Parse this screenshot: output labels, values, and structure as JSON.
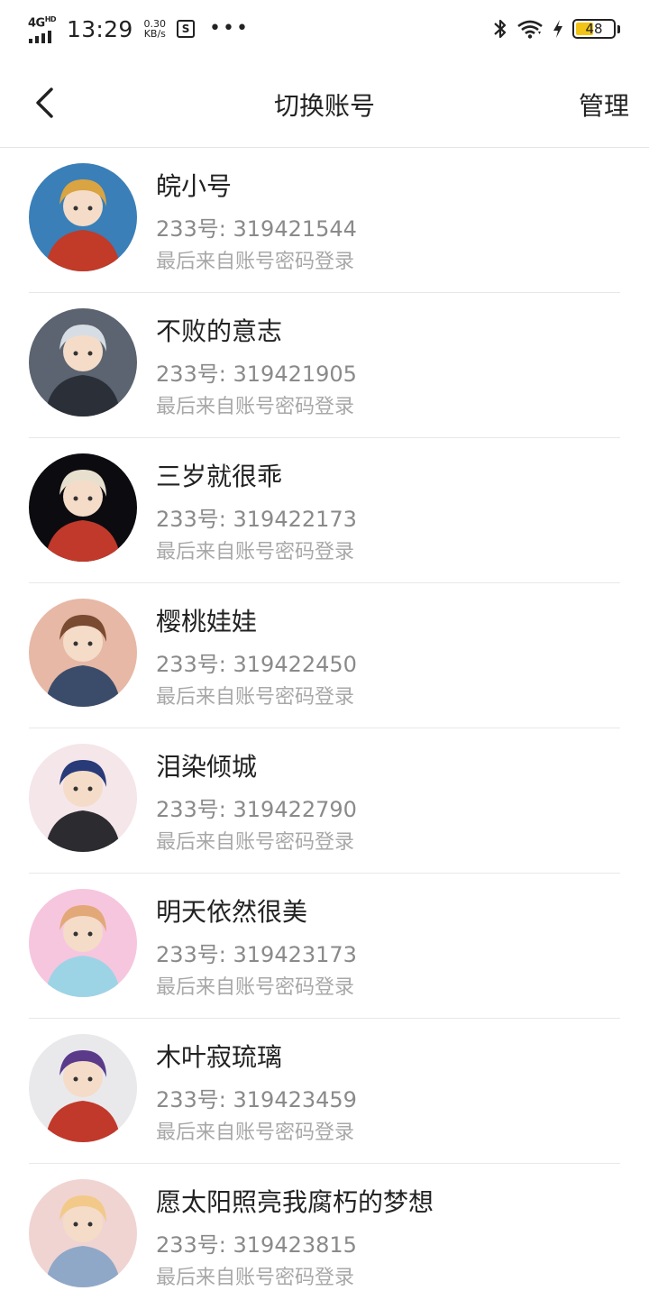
{
  "status_bar": {
    "network": "4G",
    "network_sup": "HD",
    "time": "13:29",
    "speed_value": "0.30",
    "speed_unit": "KB/s",
    "sim_glyph": "S",
    "more": "•••",
    "battery_level": "48",
    "battery_fraction": 0.48,
    "battery_color": "#f2c418",
    "icons": [
      "bluetooth-icon",
      "wifi-icon",
      "charging-icon",
      "battery-icon"
    ]
  },
  "header": {
    "back_icon": "chevron-left-icon",
    "title": "切换账号",
    "manage_label": "管理"
  },
  "accounts": [
    {
      "name": "皖小号",
      "id_text": "233号: 319421544",
      "login_text": "最后来自账号密码登录",
      "avatar_colors": [
        "#3a7fb8",
        "#d9a441",
        "#c23a28"
      ]
    },
    {
      "name": "不败的意志",
      "id_text": "233号: 319421905",
      "login_text": "最后来自账号密码登录",
      "avatar_colors": [
        "#5b6470",
        "#d7dde5",
        "#2b3038"
      ]
    },
    {
      "name": "三岁就很乖",
      "id_text": "233号: 319422173",
      "login_text": "最后来自账号密码登录",
      "avatar_colors": [
        "#0c0c10",
        "#e8e0cf",
        "#c0392b"
      ]
    },
    {
      "name": "樱桃娃娃",
      "id_text": "233号: 319422450",
      "login_text": "最后来自账号密码登录",
      "avatar_colors": [
        "#e7b8a6",
        "#7a4b30",
        "#3b4c6b"
      ]
    },
    {
      "name": "泪染倾城",
      "id_text": "233号: 319422790",
      "login_text": "最后来自账号密码登录",
      "avatar_colors": [
        "#f5e6ea",
        "#283a78",
        "#2b2b30"
      ]
    },
    {
      "name": "明天依然很美",
      "id_text": "233号: 319423173",
      "login_text": "最后来自账号密码登录",
      "avatar_colors": [
        "#f6c6de",
        "#e3a878",
        "#9cd4e6"
      ]
    },
    {
      "name": "木叶寂琉璃",
      "id_text": "233号: 319423459",
      "login_text": "最后来自账号密码登录",
      "avatar_colors": [
        "#e9e9ec",
        "#5b3a8a",
        "#c0392b"
      ]
    },
    {
      "name": "愿太阳照亮我腐朽的梦想",
      "id_text": "233号: 319423815",
      "login_text": "最后来自账号密码登录",
      "avatar_colors": [
        "#f0d4d2",
        "#f3c98a",
        "#8fa8c8"
      ]
    }
  ]
}
